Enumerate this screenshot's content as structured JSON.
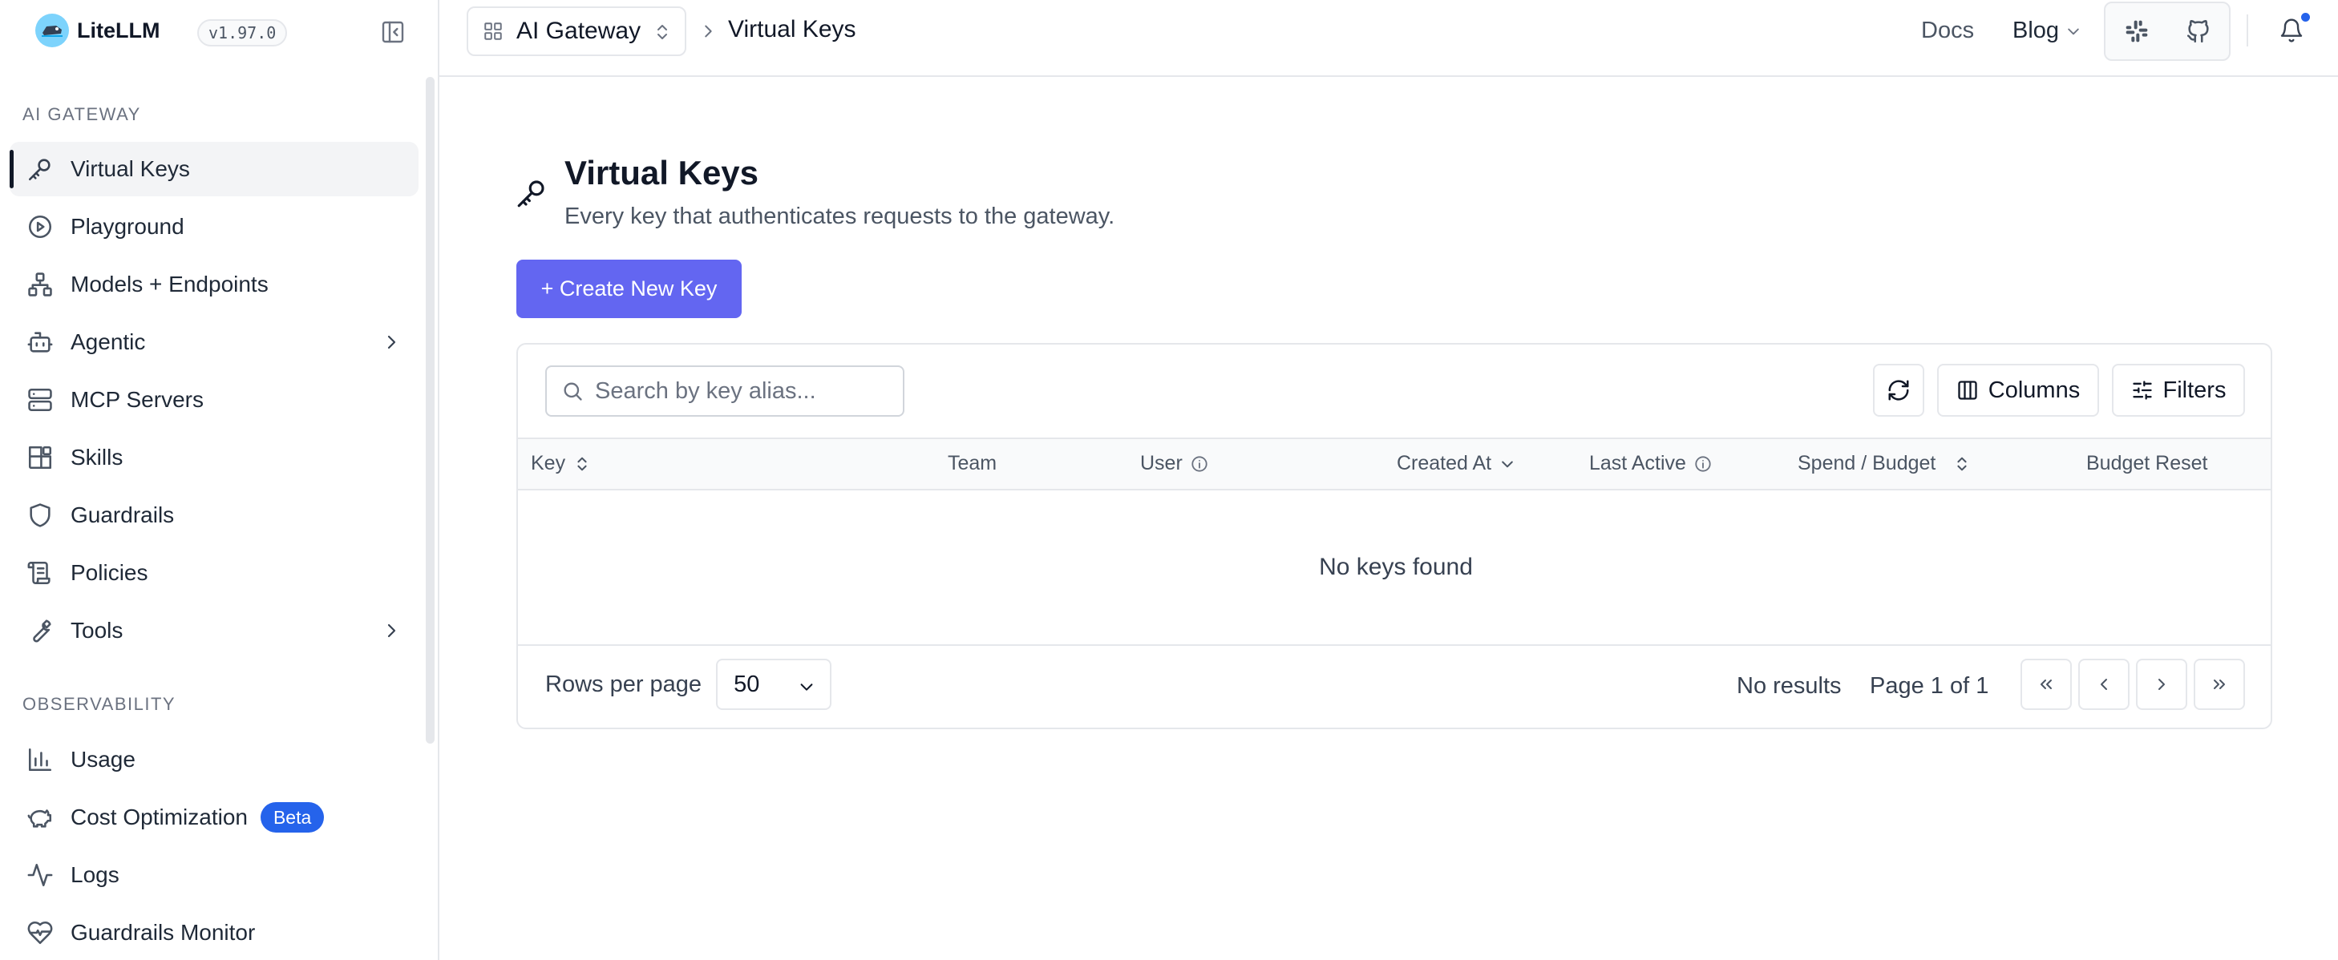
{
  "brand": {
    "name": "LiteLLM",
    "version": "v1.97.0"
  },
  "sidebar": {
    "sections": [
      {
        "label": "AI GATEWAY",
        "items": [
          {
            "label": "Virtual Keys",
            "icon": "key-icon",
            "active": true
          },
          {
            "label": "Playground",
            "icon": "play-circle-icon"
          },
          {
            "label": "Models + Endpoints",
            "icon": "network-icon"
          },
          {
            "label": "Agentic",
            "icon": "bot-icon",
            "expandable": true
          },
          {
            "label": "MCP Servers",
            "icon": "server-icon"
          },
          {
            "label": "Skills",
            "icon": "blocks-icon"
          },
          {
            "label": "Guardrails",
            "icon": "shield-icon"
          },
          {
            "label": "Policies",
            "icon": "scroll-icon"
          },
          {
            "label": "Tools",
            "icon": "wrench-icon",
            "expandable": true
          }
        ]
      },
      {
        "label": "OBSERVABILITY",
        "items": [
          {
            "label": "Usage",
            "icon": "bar-chart-icon"
          },
          {
            "label": "Cost Optimization",
            "icon": "piggy-bank-icon",
            "badge": "Beta"
          },
          {
            "label": "Logs",
            "icon": "activity-icon"
          },
          {
            "label": "Guardrails Monitor",
            "icon": "heart-pulse-icon"
          }
        ]
      }
    ]
  },
  "topbar": {
    "gateway_selector": "AI Gateway",
    "breadcrumb_current": "Virtual Keys",
    "docs_label": "Docs",
    "blog_label": "Blog",
    "notification_dot_color": "#2563eb"
  },
  "page": {
    "title": "Virtual Keys",
    "subtitle": "Every key that authenticates requests to the gateway.",
    "create_button": "+ Create New Key",
    "accent_color": "#6366f1"
  },
  "table": {
    "search_placeholder": "Search by key alias...",
    "columns_button": "Columns",
    "filters_button": "Filters",
    "headers": [
      {
        "label": "Key",
        "sort": "updown"
      },
      {
        "label": "Team"
      },
      {
        "label": "User",
        "info": true
      },
      {
        "label": "Created At",
        "sort": "down"
      },
      {
        "label": "Last Active",
        "info": true
      },
      {
        "label": "Spend / Budget",
        "sort": "updown"
      },
      {
        "label": "Budget Reset"
      }
    ],
    "empty_text": "No keys found"
  },
  "pagination": {
    "rows_per_page_label": "Rows per page",
    "rows_per_page_value": "50",
    "results_text": "No results",
    "page_text": "Page 1 of 1"
  }
}
